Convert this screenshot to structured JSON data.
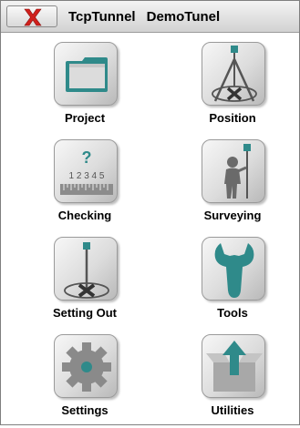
{
  "titlebar": {
    "close_icon": "close-x-icon",
    "app_name": "TcpTunnel",
    "job_name": "DemoTunel"
  },
  "menu": [
    {
      "label": "Project",
      "icon": "folder-icon"
    },
    {
      "label": "Position",
      "icon": "position-tripod-icon"
    },
    {
      "label": "Checking",
      "icon": "measuring-tape-icon"
    },
    {
      "label": "Surveying",
      "icon": "surveyor-pole-icon"
    },
    {
      "label": "Setting Out",
      "icon": "setting-out-icon"
    },
    {
      "label": "Tools",
      "icon": "wrench-icon"
    },
    {
      "label": "Settings",
      "icon": "gear-icon"
    },
    {
      "label": "Utilities",
      "icon": "upload-box-icon"
    }
  ],
  "checking_icon_text": {
    "question": "?",
    "digits": "1 2 3 4 5"
  },
  "colors": {
    "teal": "#2f8a8a",
    "close_red": "#d0201c",
    "icon_gray": "#5a5a5a"
  }
}
